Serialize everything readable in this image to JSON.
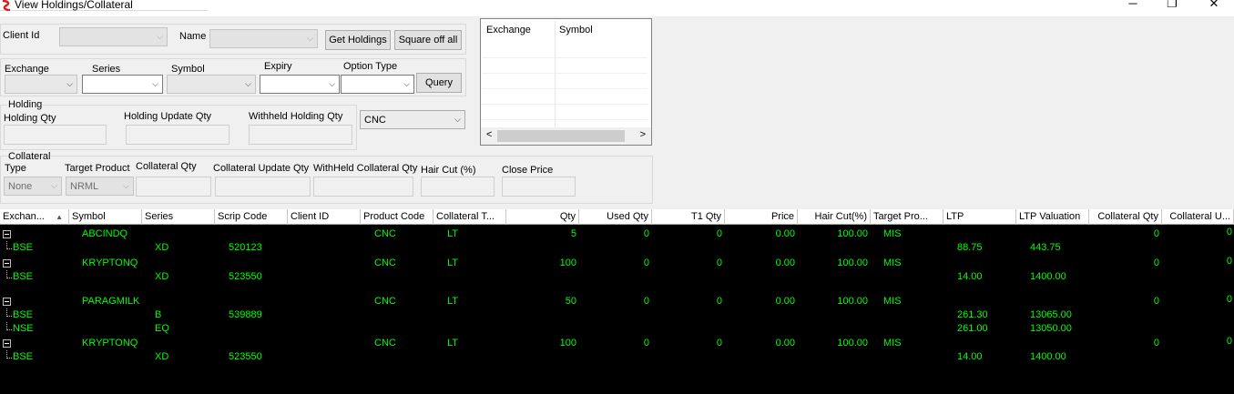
{
  "window": {
    "title": "View Holdings/Collateral",
    "minimize": "─",
    "maximize": "❐",
    "close": "✕"
  },
  "client": {
    "client_id_label": "Client Id",
    "name_label": "Name",
    "get_holdings": "Get Holdings",
    "square_off_all": "Square off all"
  },
  "filters": {
    "exchange_label": "Exchange",
    "series_label": "Series",
    "symbol_label": "Symbol",
    "expiry_label": "Expiry",
    "option_type_label": "Option Type",
    "query": "Query"
  },
  "holding": {
    "group_label": "Holding",
    "qty_label": "Holding Qty",
    "update_qty_label": "Holding Update Qty",
    "withheld_label": "Withheld Holding Qty",
    "product_value": "CNC"
  },
  "collateral": {
    "group_label": "Collateral",
    "type_label": "Type",
    "type_value": "None",
    "target_product_label": "Target Product",
    "target_product_value": "NRML",
    "qty_label": "Collateral Qty",
    "update_qty_label": "Collateral Update Qty",
    "withheld_label": "WithHeld Collateral Qty",
    "haircut_label": "Hair Cut (%)",
    "close_price_label": "Close Price"
  },
  "mini_grid": {
    "headers": [
      "Exchange",
      "Symbol"
    ],
    "scroll_left": "<",
    "scroll_right": ">"
  },
  "grid": {
    "headers": [
      "Exchan...",
      "Symbol",
      "Series",
      "Scrip Code",
      "Client ID",
      "Product Code",
      "Collateral T...",
      "Qty",
      "Used Qty",
      "T1 Qty",
      "Price",
      "Hair Cut(%)",
      "Target Pro...",
      "LTP",
      "LTP Valuation",
      "Collateral Qty",
      "Collateral U..."
    ],
    "sort_indicator": "▲",
    "rows": [
      {
        "kind": "parent",
        "symbol": "ABCINDQ",
        "product": "CNC",
        "collateral_type": "LT",
        "qty": "5",
        "used_qty": "0",
        "t1_qty": "0",
        "price": "0.00",
        "haircut": "100.00",
        "target": "MIS",
        "coll_qty": "0",
        "coll_update": "0"
      },
      {
        "kind": "child",
        "exchange": "BSE",
        "series": "XD",
        "scrip": "520123",
        "ltp": "88.75",
        "ltp_val": "443.75"
      },
      {
        "kind": "parent",
        "symbol": "KRYPTONQ",
        "product": "CNC",
        "collateral_type": "LT",
        "qty": "100",
        "used_qty": "0",
        "t1_qty": "0",
        "price": "0.00",
        "haircut": "100.00",
        "target": "MIS",
        "coll_qty": "0",
        "coll_update": "0"
      },
      {
        "kind": "child",
        "exchange": "BSE",
        "series": "XD",
        "scrip": "523550",
        "ltp": "14.00",
        "ltp_val": "1400.00"
      },
      {
        "kind": "parent",
        "symbol": "PARAGMILK",
        "product": "CNC",
        "collateral_type": "LT",
        "qty": "50",
        "used_qty": "0",
        "t1_qty": "0",
        "price": "0.00",
        "haircut": "100.00",
        "target": "MIS",
        "coll_qty": "0",
        "coll_update": "0"
      },
      {
        "kind": "child",
        "exchange": "BSE",
        "series": "B",
        "scrip": "539889",
        "ltp": "261.30",
        "ltp_val": "13065.00"
      },
      {
        "kind": "child",
        "exchange": "NSE",
        "series": "EQ",
        "scrip": "",
        "ltp": "261.00",
        "ltp_val": "13050.00"
      },
      {
        "kind": "parent",
        "symbol": "KRYPTONQ",
        "product": "CNC",
        "collateral_type": "LT",
        "qty": "100",
        "used_qty": "0",
        "t1_qty": "0",
        "price": "0.00",
        "haircut": "100.00",
        "target": "MIS",
        "coll_qty": "0",
        "coll_update": "0"
      },
      {
        "kind": "child",
        "exchange": "BSE",
        "series": "XD",
        "scrip": "523550",
        "ltp": "14.00",
        "ltp_val": "1400.00"
      }
    ]
  },
  "icons": {
    "app": "app-logo-icon",
    "dropdown": "chevron-down-icon",
    "tree_collapse": "minus-box-icon"
  },
  "colors": {
    "grid_text": "#00ff00",
    "grid_bg": "#000000",
    "window_bg": "#f0f0f0"
  }
}
